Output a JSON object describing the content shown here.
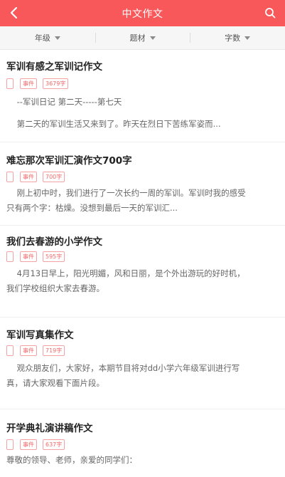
{
  "header": {
    "title": "中文作文",
    "back_icon": "back-arrow-icon",
    "search_icon": "search-icon",
    "background": "#f8585a"
  },
  "filters": [
    {
      "label": "年级"
    },
    {
      "label": "题材"
    },
    {
      "label": "字数"
    }
  ],
  "articles": [
    {
      "title": "军训有感之军训记作文",
      "tags": [
        "事件",
        "3679字"
      ],
      "excerpt": [
        "    --军训日记 第二天-----第七天",
        "",
        "    第二天的军训生活又来到了。昨天在烈日下苦练军姿而..."
      ]
    },
    {
      "title": "难忘那次军训汇演作文700字",
      "tags": [
        "事件",
        "700字"
      ],
      "excerpt": [
        "    刚上初中时，我们进行了一次长约一周的军训。军训时我的感受",
        "只有两个字：枯燥。没想到最后一天的军训汇..."
      ]
    },
    {
      "title": "我们去春游的小学作文",
      "tags": [
        "事件",
        "595字"
      ],
      "excerpt": [
        "    4月13日早上，阳光明媚，风和日丽，是个外出游玩的好时机，",
        "我们学校组织大家去春游。"
      ]
    },
    {
      "title": "军训写真集作文",
      "tags": [
        "事件",
        "719字"
      ],
      "excerpt": [
        "    观众朋友们，大家好，本期节目将对dd小学六年级军训进行写",
        "真，请大家观看下面片段。"
      ]
    },
    {
      "title": "开学典礼演讲稿作文",
      "tags": [
        "事件",
        "637字"
      ],
      "excerpt": [
        "尊敬的领导、老师，亲爱的同学们："
      ]
    }
  ]
}
